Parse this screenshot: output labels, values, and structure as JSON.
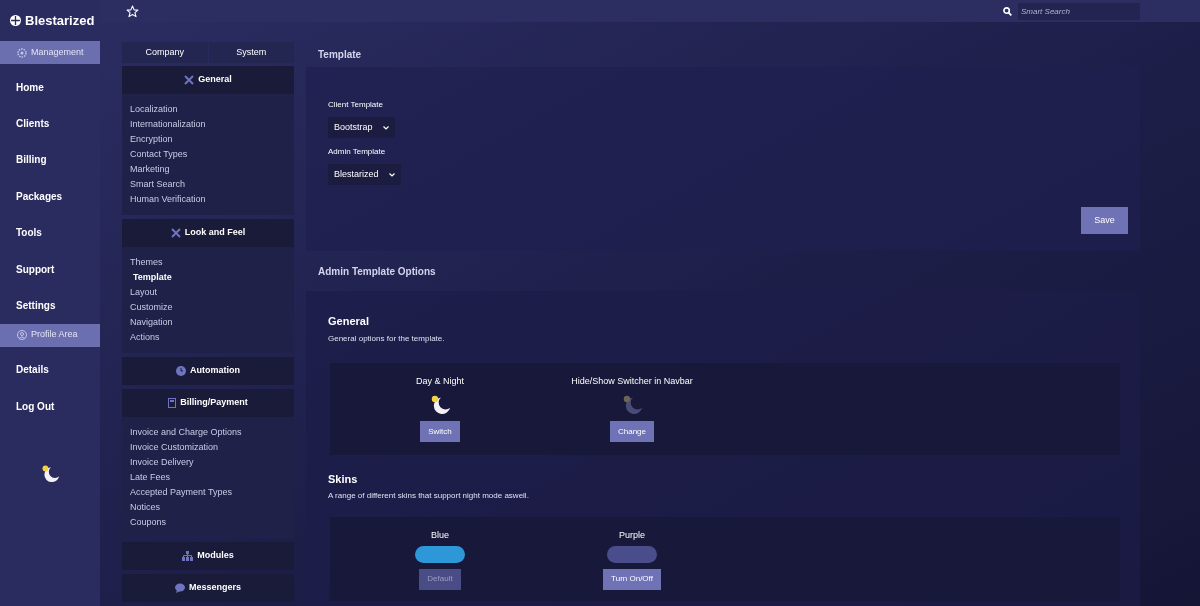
{
  "brand": {
    "name": "Blestarized"
  },
  "sidebar": {
    "items": [
      {
        "kind": "section",
        "label": "Management"
      },
      {
        "kind": "link",
        "label": "Home"
      },
      {
        "kind": "link",
        "label": "Clients"
      },
      {
        "kind": "link",
        "label": "Billing"
      },
      {
        "kind": "link",
        "label": "Packages"
      },
      {
        "kind": "link",
        "label": "Tools"
      },
      {
        "kind": "link",
        "label": "Support"
      },
      {
        "kind": "link",
        "label": "Settings"
      },
      {
        "kind": "section",
        "label": "Profile Area"
      },
      {
        "kind": "link",
        "label": "Details"
      },
      {
        "kind": "link",
        "label": "Log Out"
      }
    ]
  },
  "search": {
    "placeholder": "Smart Search"
  },
  "settings_tabs": [
    {
      "label": "Company",
      "selected": false
    },
    {
      "label": "System",
      "selected": false
    }
  ],
  "settings_groups": [
    {
      "title": "General",
      "items": [
        {
          "label": "Localization",
          "selected": false
        },
        {
          "label": "Internationalization",
          "selected": false
        },
        {
          "label": "Encryption",
          "selected": false
        },
        {
          "label": "Contact Types",
          "selected": false
        },
        {
          "label": "Marketing",
          "selected": false
        },
        {
          "label": "Smart Search",
          "selected": false
        },
        {
          "label": "Human Verification",
          "selected": false
        }
      ]
    },
    {
      "title": "Look and Feel",
      "items": [
        {
          "label": "Themes",
          "selected": false
        },
        {
          "label": "Template",
          "selected": true
        },
        {
          "label": "Layout",
          "selected": false
        },
        {
          "label": "Customize",
          "selected": false
        },
        {
          "label": "Navigation",
          "selected": false
        },
        {
          "label": "Actions",
          "selected": false
        }
      ]
    },
    {
      "title": "Automation"
    },
    {
      "title": "Billing/Payment",
      "items": [
        {
          "label": "Invoice and Charge Options",
          "selected": false
        },
        {
          "label": "Invoice Customization",
          "selected": false
        },
        {
          "label": "Invoice Delivery",
          "selected": false
        },
        {
          "label": "Late Fees",
          "selected": false
        },
        {
          "label": "Accepted Payment Types",
          "selected": false
        },
        {
          "label": "Notices",
          "selected": false
        },
        {
          "label": "Coupons",
          "selected": false
        }
      ]
    },
    {
      "title": "Modules"
    },
    {
      "title": "Messengers"
    }
  ],
  "template": {
    "title": "Template",
    "fields": [
      {
        "label": "Client Template",
        "value": "Bootstrap"
      },
      {
        "label": "Admin Template",
        "value": "Blestarized"
      }
    ],
    "save_button": "Save"
  },
  "options": {
    "title": "Admin Template Options",
    "general": {
      "heading": "General",
      "description": "General options for the template.",
      "toggles": [
        {
          "label": "Day & Night",
          "active": true,
          "button": "Switch"
        },
        {
          "label": "Hide/Show Switcher in Navbar",
          "active": false,
          "button": "Change"
        }
      ]
    },
    "skins": {
      "heading": "Skins",
      "description": "A range of different skins that support night mode aswell.",
      "items": [
        {
          "label": "Blue",
          "color": "#2e97d8",
          "button": "Default",
          "disabled": true
        },
        {
          "label": "Purple",
          "color": "#4a4d8c",
          "button": "Turn On/Off",
          "disabled": false
        }
      ]
    }
  }
}
